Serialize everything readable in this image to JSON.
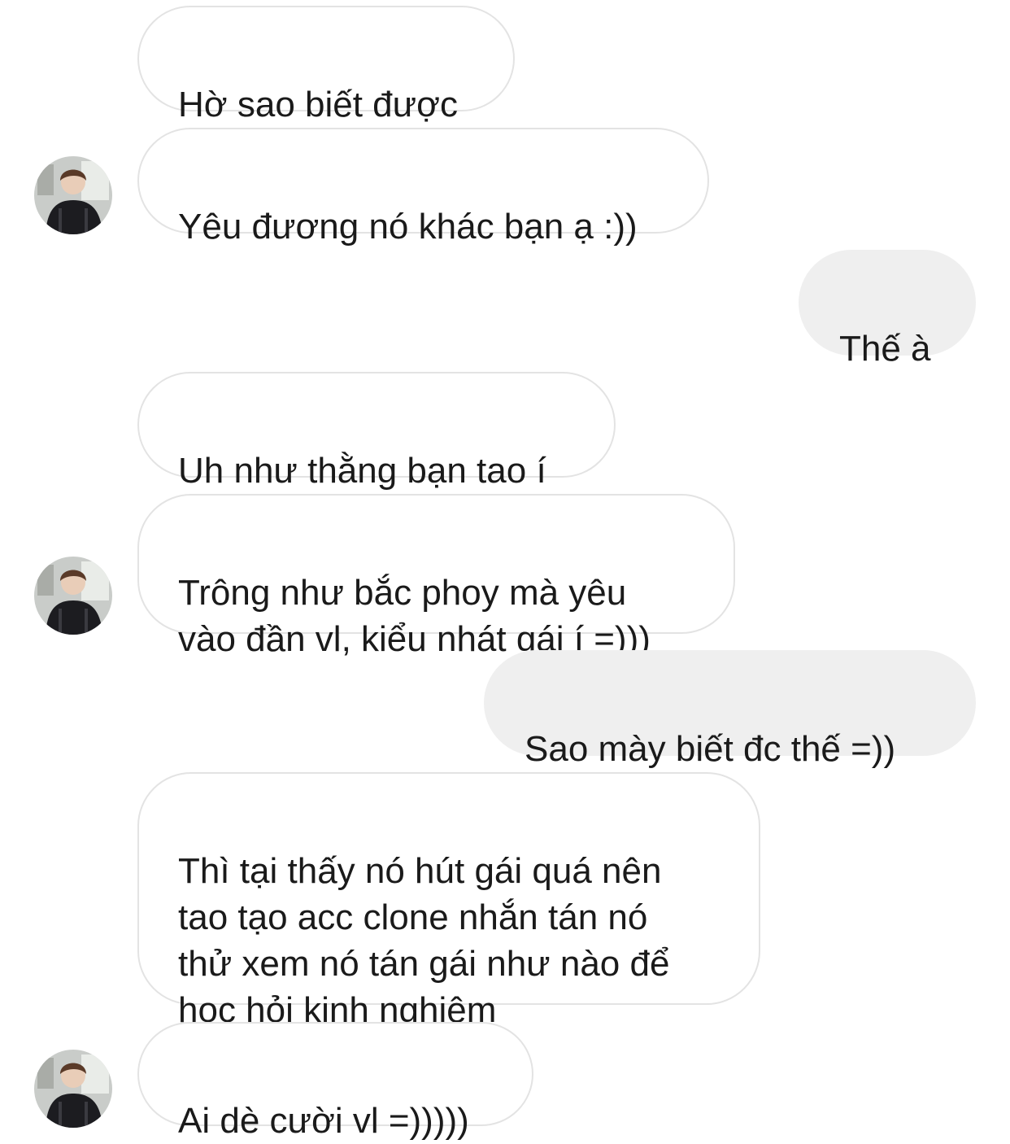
{
  "conversation": {
    "messages": [
      {
        "sender": "them",
        "text": "Hờ sao biết được"
      },
      {
        "sender": "them",
        "text": "Yêu đương nó khác bạn ạ :))"
      },
      {
        "sender": "me",
        "text": "Thế à"
      },
      {
        "sender": "them",
        "text": "Uh như thằng bạn tao í"
      },
      {
        "sender": "them",
        "text": "Trông như bắc phoy mà yêu\nvào đần vl, kiểu nhát gái í =)))"
      },
      {
        "sender": "me",
        "text": "Sao mày biết đc thế =))"
      },
      {
        "sender": "them",
        "text": "Thì tại thấy nó hút gái quá nên\ntao tạo acc clone nhắn tán nó\nthử xem nó tán gái như nào để\nhọc hỏi kinh nghiệm"
      },
      {
        "sender": "them",
        "text": "Ai dè cười vl =)))))"
      }
    ]
  },
  "colors": {
    "incoming_bubble_border": "#e3e3e3",
    "outgoing_bubble_fill": "#efefef",
    "text": "#1a1a1a",
    "background": "#ffffff"
  }
}
